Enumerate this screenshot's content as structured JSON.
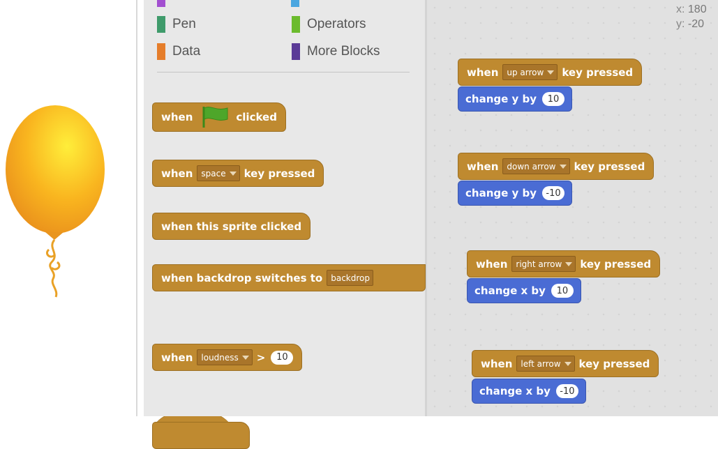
{
  "categories": {
    "pen": "Pen",
    "operators": "Operators",
    "data": "Data",
    "more_blocks": "More Blocks",
    "colors": {
      "pen": "#3f9b6b",
      "operators": "#6bbb2d",
      "data": "#e57d2a",
      "more_blocks": "#5b3b97",
      "looks": "#a24fd0",
      "sensing": "#4aa6e0"
    }
  },
  "stage": {
    "x_label": "x:",
    "x_value": "180",
    "y_label": "y:",
    "y_value": "-20",
    "sprite": "balloon"
  },
  "palette_blocks": {
    "flag": {
      "when": "when",
      "clicked": "clicked"
    },
    "key": {
      "when": "when",
      "key": "space",
      "pressed": "key pressed"
    },
    "sprite_clicked": {
      "label": "when this sprite clicked"
    },
    "backdrop": {
      "label": "when backdrop switches to",
      "value": "backdrop"
    },
    "loudness": {
      "when": "when",
      "sensor": "loudness",
      "op": ">",
      "value": "10"
    }
  },
  "scripts": [
    {
      "when": "when",
      "key": "up arrow",
      "pressed": "key pressed",
      "action": "change y by",
      "value": "10"
    },
    {
      "when": "when",
      "key": "down arrow",
      "pressed": "key pressed",
      "action": "change y by",
      "value": "-10"
    },
    {
      "when": "when",
      "key": "right arrow",
      "pressed": "key pressed",
      "action": "change x by",
      "value": "10"
    },
    {
      "when": "when",
      "key": "left arrow",
      "pressed": "key pressed",
      "action": "change x by",
      "value": "-10"
    }
  ]
}
